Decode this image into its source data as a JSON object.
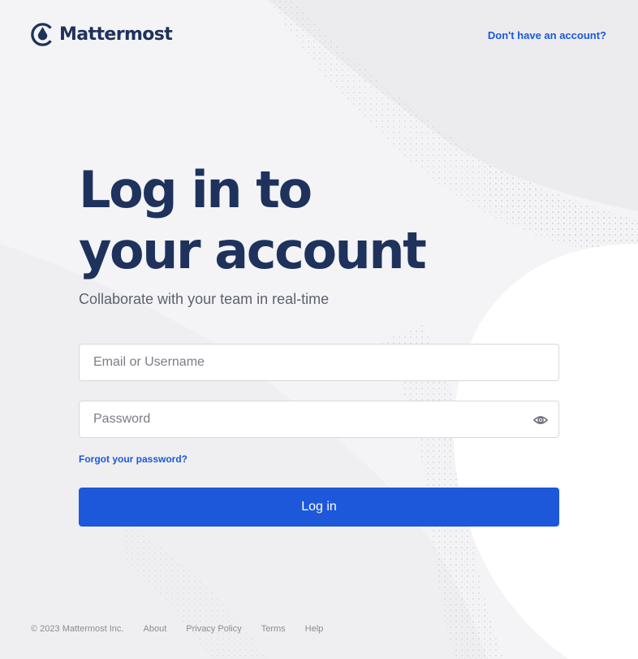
{
  "header": {
    "brand": "Mattermost",
    "signup_link": "Don't have an account?"
  },
  "main": {
    "title_line1": "Log in to",
    "title_line2": "your account",
    "subtitle": "Collaborate with your team in real-time"
  },
  "form": {
    "email_placeholder": "Email or Username",
    "email_value": "",
    "password_placeholder": "Password",
    "password_value": "",
    "forgot_link": "Forgot your password?",
    "login_button": "Log in",
    "password_toggle_icon": "eye-icon"
  },
  "footer": {
    "copyright": "© 2023 Mattermost Inc.",
    "links": [
      "About",
      "Privacy Policy",
      "Terms",
      "Help"
    ]
  },
  "colors": {
    "brand": "#1e325c",
    "accent": "#1c58d9",
    "background": "#f4f4f6"
  }
}
